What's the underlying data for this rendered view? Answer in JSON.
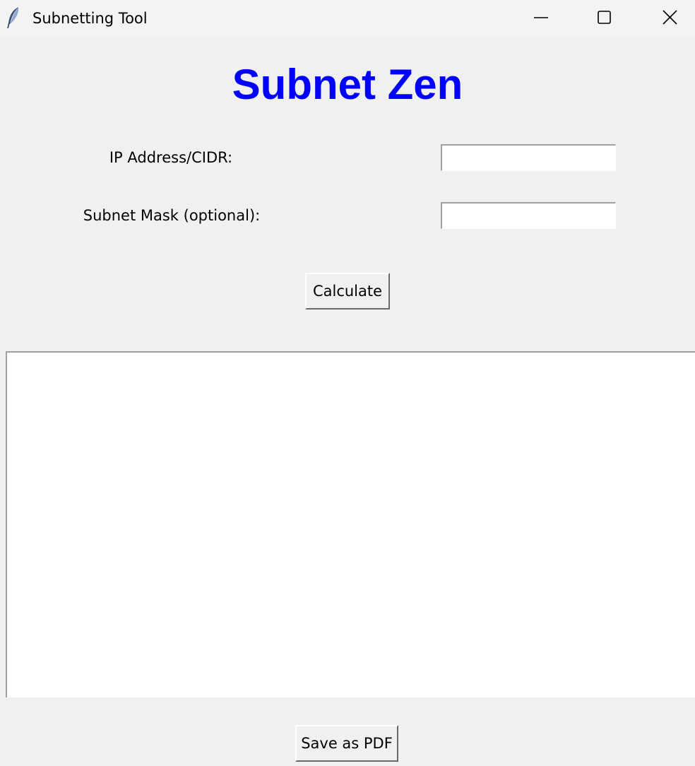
{
  "window": {
    "title": "Subnetting Tool",
    "icon": "feather-icon",
    "controls": [
      "minimize-icon",
      "maximize-icon",
      "close-icon"
    ]
  },
  "heading": {
    "text": "Subnet Zen",
    "color": "#0000ff"
  },
  "form": {
    "ip_label": "IP Address/CIDR:",
    "ip_value": "",
    "mask_label": "Subnet Mask (optional):",
    "mask_value": "",
    "calculate_label": "Calculate"
  },
  "output": {
    "text": ""
  },
  "footer": {
    "save_label": "Save as PDF"
  }
}
